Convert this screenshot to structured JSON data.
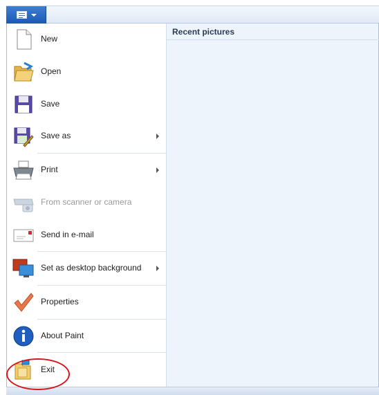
{
  "app_menu": {
    "button_icon": "paint-menu-icon",
    "items": [
      {
        "label": "New",
        "icon": "new-document-icon",
        "enabled": true,
        "submenu": false
      },
      {
        "label": "Open",
        "icon": "open-folder-icon",
        "enabled": true,
        "submenu": false
      },
      {
        "label": "Save",
        "icon": "floppy-disk-icon",
        "enabled": true,
        "submenu": false
      },
      {
        "label": "Save as",
        "icon": "save-as-icon",
        "enabled": true,
        "submenu": true
      },
      {
        "label": "Print",
        "icon": "printer-icon",
        "enabled": true,
        "submenu": true
      },
      {
        "label": "From scanner or camera",
        "icon": "scanner-camera-icon",
        "enabled": false,
        "submenu": false
      },
      {
        "label": "Send in e-mail",
        "icon": "email-envelope-icon",
        "enabled": true,
        "submenu": false
      },
      {
        "label": "Set as desktop background",
        "icon": "desktop-background-icon",
        "enabled": true,
        "submenu": true
      },
      {
        "label": "Properties",
        "icon": "checkmark-icon",
        "enabled": true,
        "submenu": false
      },
      {
        "label": "About Paint",
        "icon": "info-icon",
        "enabled": true,
        "submenu": false
      },
      {
        "label": "Exit",
        "icon": "exit-folder-icon",
        "enabled": true,
        "submenu": false
      }
    ]
  },
  "recent": {
    "header": "Recent pictures",
    "items": []
  },
  "colors": {
    "menu_button": "#1b58b6",
    "right_panel": "#eef4fc",
    "annotation_circle": "#d8161d"
  }
}
